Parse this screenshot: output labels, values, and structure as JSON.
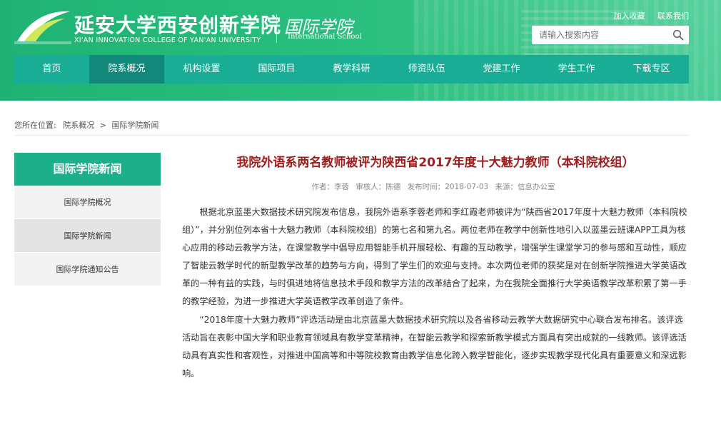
{
  "header": {
    "school_name": "延安大学西安创新学院",
    "school_name_en": "XI'AN INNOVATION COLLEGE OF YAN'AN UNIVERSITY",
    "sub_name": "国际学院",
    "sub_name_en": "International School",
    "top_links": [
      "加入收藏",
      "联系我们"
    ],
    "search_placeholder": "请输入搜索内容",
    "colors": {
      "primary": "#1fb274",
      "nav": "#19ad95",
      "nav_active": "#12887a"
    }
  },
  "nav": {
    "items": [
      "首页",
      "院系概况",
      "机构设置",
      "国际项目",
      "教学科研",
      "师资队伍",
      "党建工作",
      "学生工作",
      "下载专区"
    ],
    "active_index": 1
  },
  "breadcrumb": {
    "prefix": "您所在位置:",
    "items": [
      "院系概况",
      "国际学院新闻"
    ],
    "separator": ">"
  },
  "sidebar": {
    "title": "国际学院新闻",
    "items": [
      "国际学院概况",
      "国际学院新闻",
      "国际学院通知公告"
    ],
    "active_index": 1
  },
  "article": {
    "title": "我院外语系两名教师被评为陕西省2017年度十大魅力教师（本科院校组）",
    "meta": {
      "author": "作者：李蓉",
      "reviewer": "审核人：陈德",
      "published": "发布时间：2018-07-03",
      "source": "来源：信息办公室"
    },
    "paragraphs": [
      "根据北京蓝墨大数据技术研究院发布信息，我院外语系李蓉老师和李红霞老师被评为“陕西省2017年度十大魅力教师（本科院校组）”，并分别位列本省十大魅力教师（本科院校组）的第七名和第九名。两位老师在教学中创新性地引入以蓝墨云班课APP工具为核心应用的移动云教学方法，在课堂教学中倡导应用智能手机开展轻松、有趣的互动教学，增强学生课堂学习的参与感和互动性，顺应了智能云教学时代的新型教学改革的趋势与方向，得到了学生们的欢迎与支持。本次两位老师的获奖是对在创新学院推进大学英语改革的一种有益的实践，与时俱进地将信息技术手段和教学方法的改革结合了起来，为在我院全面推行大学英语教学改革积累了第一手的教学经验，为进一步推进大学英语教学改革创造了条件。",
      "“2018年度十大魅力教师”评选活动是由北京蓝墨大数据技术研究院以及各省移动云教学大数据研究中心联合发布排名。该评选活动旨在表彰中国大学和职业教育领域具有教学变革精神，在智能云教学和探索新教学模式方面具有突出成就的一线教师。该评选活动具有真实性和客观性，对推进中国高等和中等院校教育由教学信息化跨入教学智能化，逐步实现教学现代化具有重要意义和深远影响。"
    ]
  }
}
